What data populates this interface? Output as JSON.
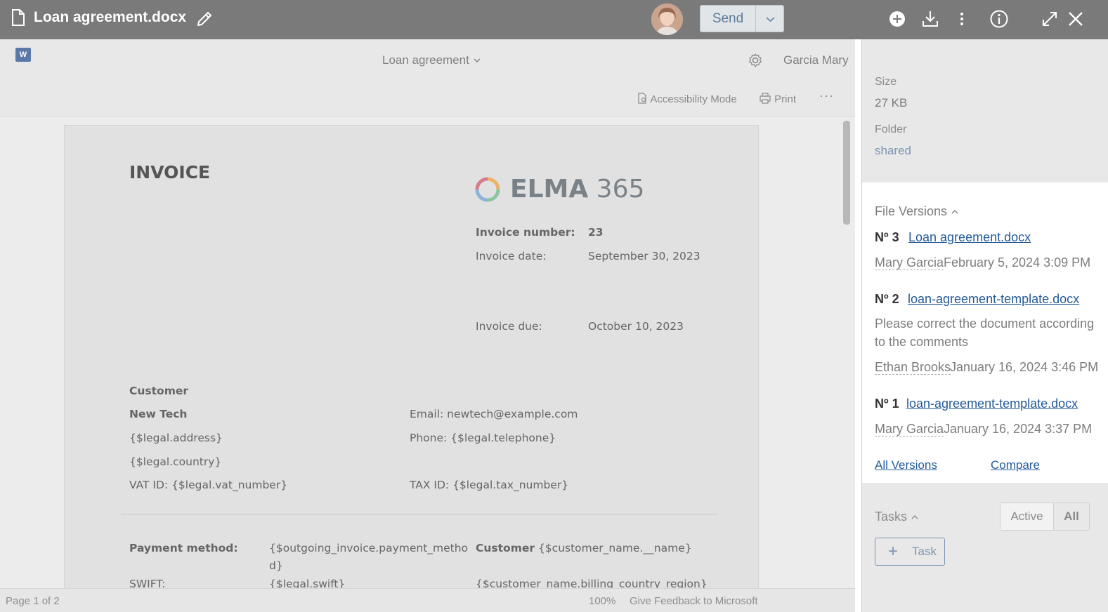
{
  "topbar": {
    "file_title": "Loan agreement.docx",
    "send_label": "Send",
    "icons": [
      "document-icon",
      "pencil-icon",
      "plus-circle-icon",
      "download-icon",
      "kebab-icon",
      "info-icon",
      "expand-icon",
      "close-icon"
    ]
  },
  "word": {
    "app_logo": "W",
    "document_name": "Loan agreement",
    "user_name": "Garcia Mary",
    "accessibility_label": "Accessibility Mode",
    "print_label": "Print",
    "more_label": "···",
    "status_page": "Page 1 of 2",
    "status_zoom": "100%",
    "status_feedback": "Give Feedback to Microsoft"
  },
  "invoice": {
    "heading": "INVOICE",
    "logo_text_bold": "ELMA",
    "logo_text_light": " 365",
    "number_label": "Invoice number:",
    "number_value": "23",
    "date_label": "Invoice date:",
    "date_value": "September 30, 2023",
    "due_label": "Invoice due:",
    "due_value": "October 10, 2023",
    "customer_heading": "Customer",
    "customer_name": "New Tech",
    "address": "{$legal.address}",
    "country": "{$legal.country}",
    "vat": "VAT ID: {$legal.vat_number}",
    "email": "Email: newtech@example.com",
    "phone": "Phone: {$legal.telephone}",
    "tax": "TAX ID: {$legal.tax_number}",
    "payment_label": "Payment method:",
    "payment_value_1": "{$outgoing_invoice.payment_metho",
    "payment_value_2": "d}",
    "swift_label": "SWIFT:",
    "swift_value": "{$legal.swift}",
    "customer2_label": "Customer",
    "customer2_value": " {$customer_name.__name}",
    "customer_region": "{$customer_name.billing_country_region}"
  },
  "panel": {
    "size_label": "Size",
    "size_value": "27 KB",
    "folder_label": "Folder",
    "folder_value": "shared",
    "versions_title": "File Versions",
    "versions": [
      {
        "num": "Nº 3",
        "file": "Loan agreement.docx",
        "author": "Mary Garcia",
        "date": "February 5, 2024 3:09 PM",
        "comment": ""
      },
      {
        "num": "Nº 2",
        "file": "loan-agreement-template.docx",
        "author": "Ethan Brooks",
        "date": "January 16, 2024 3:46 PM",
        "comment": "Please correct the document according to the comments"
      },
      {
        "num": "Nº 1",
        "file": "loan-agreement-template.docx",
        "author": "Mary Garcia",
        "date": "January 16, 2024 3:37 PM",
        "comment": ""
      }
    ],
    "all_versions_label": "All Versions",
    "compare_label": "Compare",
    "tasks_title": "Tasks",
    "tab_active": "Active",
    "tab_all": "All",
    "task_button": "Task"
  }
}
